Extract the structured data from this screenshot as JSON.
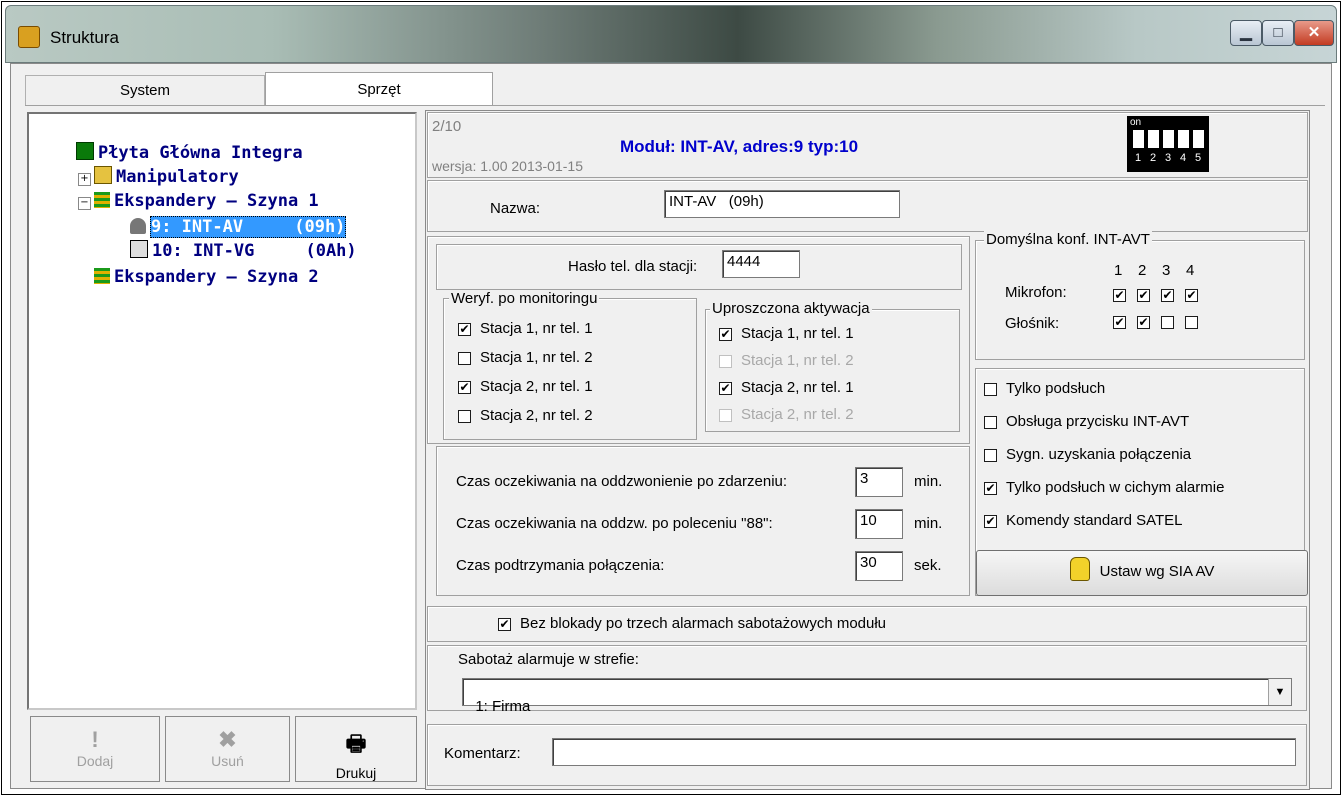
{
  "window": {
    "title": "Struktura",
    "min_label": "▁",
    "max_label": "□",
    "close_label": "✕"
  },
  "tabs": [
    {
      "label": "System"
    },
    {
      "label": "Sprzęt"
    }
  ],
  "tree": {
    "root": "Płyta Główna Integra",
    "items": [
      {
        "label": "Manipulatory",
        "expander": "+"
      },
      {
        "label": "Ekspandery – Szyna 1",
        "expander": "−"
      },
      {
        "label": "9: INT-AV     (09h)",
        "selected": true
      },
      {
        "label": "10: INT-VG     (0Ah)"
      },
      {
        "label": "Ekspandery – Szyna 2"
      }
    ]
  },
  "buttons": {
    "add": {
      "label": "Dodaj",
      "icon": "exclamation-icon",
      "glyph": "!"
    },
    "remove": {
      "label": "Usuń",
      "icon": "x-icon",
      "glyph": "✖"
    },
    "print": {
      "label": "Drukuj",
      "icon": "printer-icon",
      "glyph": "🖶"
    }
  },
  "module": {
    "counter": "2/10",
    "title": "Moduł: INT-AV, adres:9 typ:10",
    "version": "wersja: 1.00 2013-01-15",
    "dip_on": "on",
    "dip_numbers": [
      "1",
      "2",
      "3",
      "4",
      "5"
    ],
    "title_color": "#0000cc"
  },
  "name": {
    "label": "Nazwa:",
    "value": "INT-AV   (09h)"
  },
  "password": {
    "label": "Hasło tel. dla stacji:",
    "value": "4444"
  },
  "verify": {
    "title": "Weryf. po monitoringu",
    "items": [
      {
        "label": "Stacja 1, nr tel. 1",
        "checked": true
      },
      {
        "label": "Stacja 1, nr tel. 2",
        "checked": false
      },
      {
        "label": "Stacja 2, nr tel. 1",
        "checked": true
      },
      {
        "label": "Stacja 2, nr tel. 2",
        "checked": false
      }
    ]
  },
  "simplified": {
    "title": "Uproszczona aktywacja",
    "items": [
      {
        "label": "Stacja 1, nr tel. 1",
        "checked": true,
        "enabled": true
      },
      {
        "label": "Stacja 1, nr tel. 2",
        "checked": false,
        "enabled": false
      },
      {
        "label": "Stacja 2, nr tel. 1",
        "checked": true,
        "enabled": true
      },
      {
        "label": "Stacja 2, nr tel. 2",
        "checked": false,
        "enabled": false
      }
    ]
  },
  "avt": {
    "title": "Domyślna konf. INT-AVT",
    "cols": [
      "1",
      "2",
      "3",
      "4"
    ],
    "mic_label": "Mikrofon:",
    "mic": [
      true,
      true,
      true,
      true
    ],
    "spk_label": "Głośnik:",
    "spk": [
      true,
      true,
      false,
      false
    ]
  },
  "times": [
    {
      "label": "Czas oczekiwania na oddzwonienie po zdarzeniu:",
      "value": "3",
      "unit": "min."
    },
    {
      "label": "Czas oczekiwania na oddzw. po poleceniu \"88\":",
      "value": "10",
      "unit": "min."
    },
    {
      "label": "Czas podtrzymania połączenia:",
      "value": "30",
      "unit": "sek."
    }
  ],
  "options": [
    {
      "label": "Tylko podsłuch",
      "checked": false
    },
    {
      "label": "Obsługa przycisku INT-AVT",
      "checked": false
    },
    {
      "label": "Sygn. uzyskania połączenia",
      "checked": false
    },
    {
      "label": "Tylko podsłuch w cichym alarmie",
      "checked": true
    },
    {
      "label": "Komendy standard SATEL",
      "checked": true
    }
  ],
  "sia_button": {
    "label": "Ustaw wg SIA AV",
    "icon": "hand-icon"
  },
  "no_block": {
    "label": "Bez blokady po trzech alarmach sabotażowych modułu",
    "checked": true
  },
  "tamper": {
    "label": "Sabotaż alarmuje w strefie:",
    "value": "1: Firma"
  },
  "comment": {
    "label": "Komentarz:",
    "value": ""
  }
}
